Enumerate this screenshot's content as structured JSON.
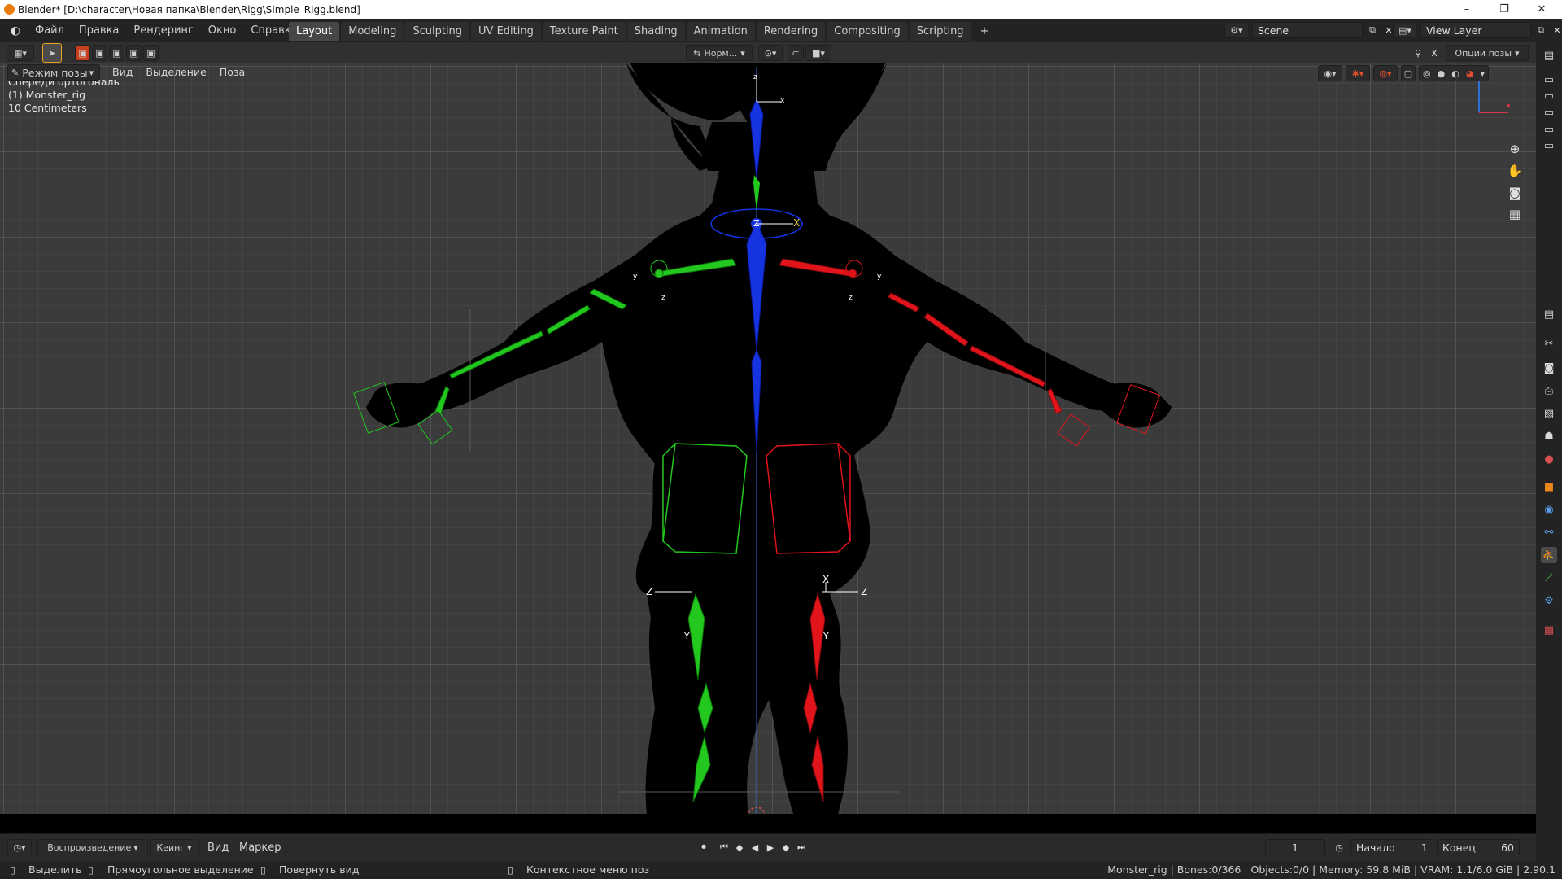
{
  "window": {
    "title": "Blender* [D:\\character\\Новая папка\\Blender\\Rigg\\Simple_Rigg.blend]",
    "minimize": "–",
    "maximize": "❐",
    "close": "✕"
  },
  "menubar": {
    "items": [
      "Файл",
      "Правка",
      "Рендеринг",
      "Окно",
      "Справка"
    ],
    "workspaces": [
      "Layout",
      "Modeling",
      "Sculpting",
      "UV Editing",
      "Texture Paint",
      "Shading",
      "Animation",
      "Rendering",
      "Compositing",
      "Scripting"
    ],
    "active_workspace": "Layout",
    "add_workspace": "+",
    "scene": "Scene",
    "view_layer": "View Layer"
  },
  "toolbar": {
    "orientation": "Норм...",
    "options": "Опции позы"
  },
  "header": {
    "mode": "Режим позы",
    "menus": [
      "Вид",
      "Выделение",
      "Поза"
    ]
  },
  "overlay": {
    "view_name": "Спереди ортогональ",
    "object": "(1) Monster_rig",
    "scale": "10 Centimeters"
  },
  "gizmo_axes": {
    "x": "x",
    "y": "y",
    "z": "z",
    "X": "X",
    "Y": "Y",
    "Z": "Z"
  },
  "timeline": {
    "playback": "Воспроизведение",
    "keying": "Кеинг",
    "view": "Вид",
    "marker": "Маркер",
    "current_frame": "1",
    "start_label": "Начало",
    "start": "1",
    "end_label": "Конец",
    "end": "60"
  },
  "status": {
    "select": "Выделить",
    "box_select": "Прямоугольное выделение",
    "rotate": "Повернуть вид",
    "context_menu": "Контекстное меню поз",
    "info": "Monster_rig | Bones:0/366 | Objects:0/0 | Memory: 59.8 MiB | VRAM: 1.1/6.0 GiB | 2.90.1"
  },
  "colors": {
    "left_side": "#22c81e",
    "right_side": "#e0141a",
    "center": "#1633e0",
    "accent": "#e8a21a"
  }
}
